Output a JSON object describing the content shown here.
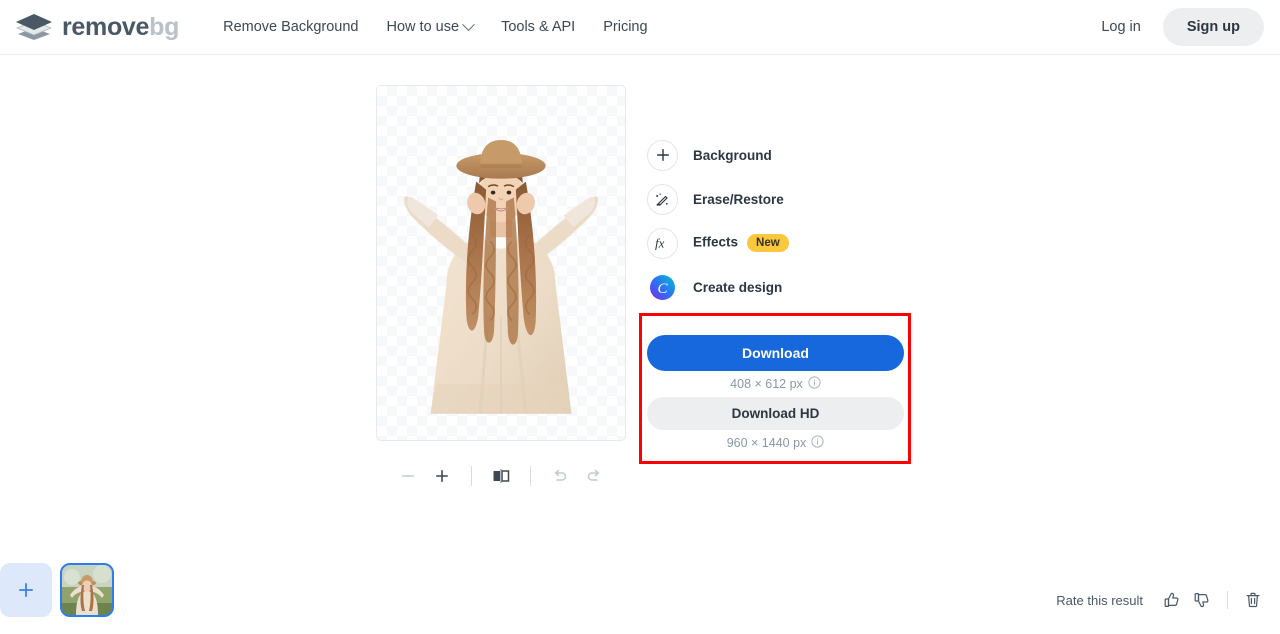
{
  "header": {
    "logo": {
      "icon": "layers-icon",
      "text_primary": "remove",
      "text_secondary": "bg"
    },
    "nav": [
      {
        "label": "Remove Background",
        "has_chevron": false
      },
      {
        "label": "How to use",
        "has_chevron": true
      },
      {
        "label": "Tools & API",
        "has_chevron": false
      },
      {
        "label": "Pricing",
        "has_chevron": false
      }
    ],
    "login_label": "Log in",
    "signup_label": "Sign up"
  },
  "editor": {
    "canvas": {
      "alt": "Woman with long curly auburn hair wearing a tan wide-brim hat and cream dress, hands raised near her face, on a transparent checkerboard background"
    },
    "toolbar": [
      {
        "name": "zoom-out-icon",
        "state": "disabled"
      },
      {
        "name": "zoom-in-icon",
        "state": "enabled"
      },
      {
        "name": "compare-icon",
        "state": "enabled"
      },
      {
        "name": "undo-icon",
        "state": "disabled"
      },
      {
        "name": "redo-icon",
        "state": "disabled"
      }
    ]
  },
  "panel": {
    "options": [
      {
        "label": "Background",
        "icon": "plus-icon",
        "badge": null
      },
      {
        "label": "Erase/Restore",
        "icon": "magic-brush-icon",
        "badge": null
      },
      {
        "label": "Effects",
        "icon": "fx-icon",
        "badge": "New"
      },
      {
        "label": "Create design",
        "icon": "canva-icon",
        "badge": null
      }
    ]
  },
  "download": {
    "primary_label": "Download",
    "primary_dimensions": "408 × 612 px",
    "hd_label": "Download HD",
    "hd_dimensions": "960 × 1440 px",
    "info_icon": "info-icon",
    "highlight_color": "#ff0000",
    "primary_color": "#1668dc"
  },
  "bottom": {
    "add_icon": "plus-icon",
    "thumbnail_alt": "Original photo thumbnail with green outdoor background",
    "rate_label": "Rate this result",
    "thumbs_up_icon": "thumbs-up-icon",
    "thumbs_down_icon": "thumbs-down-icon",
    "delete_icon": "trash-icon"
  }
}
